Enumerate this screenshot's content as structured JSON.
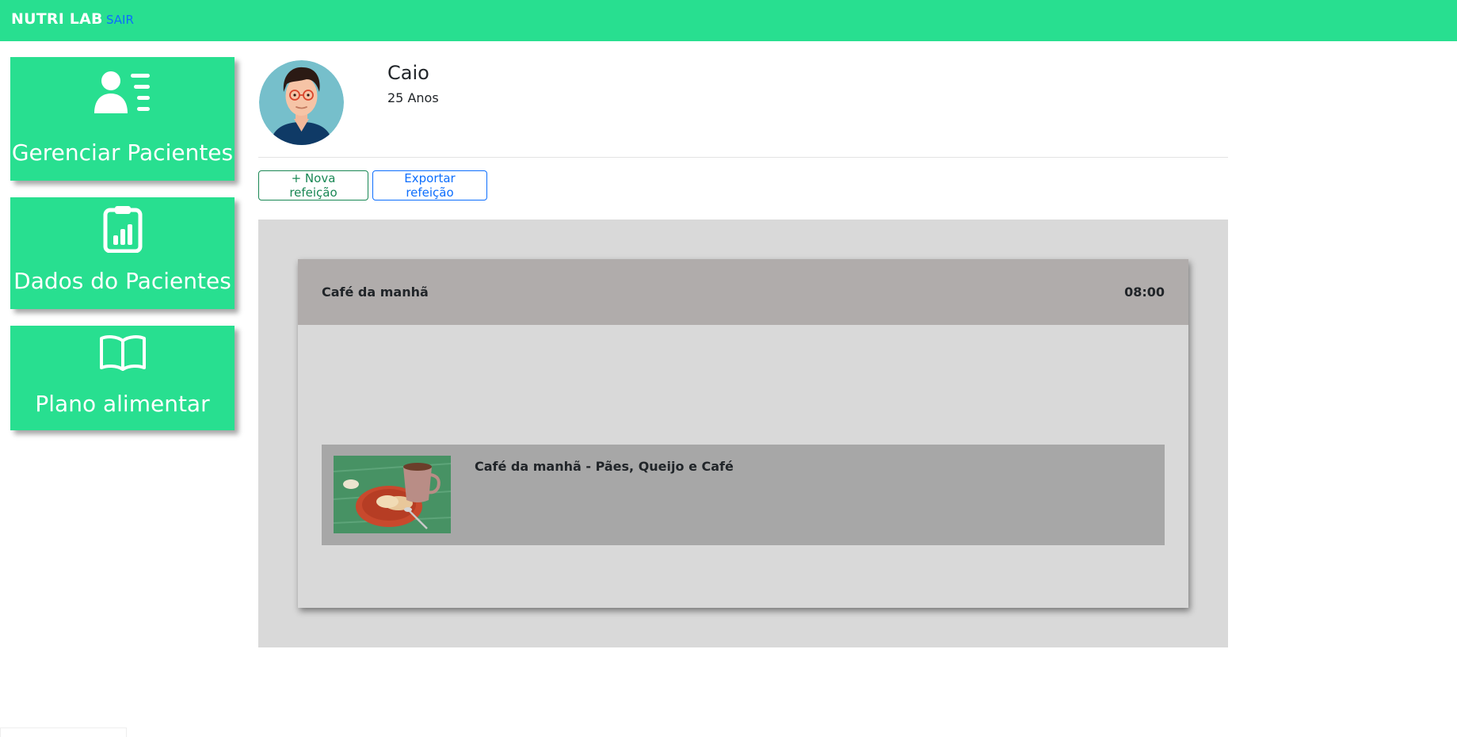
{
  "topbar": {
    "brand": "NUTRI LAB",
    "logout_label": "SAIR",
    "background": "#28df90"
  },
  "sidebar": {
    "items": [
      {
        "label": "Gerenciar Pacientes",
        "icon": "users-list-icon"
      },
      {
        "label": "Dados do Pacientes",
        "icon": "clipboard-chart-icon"
      },
      {
        "label": "Plano alimentar",
        "icon": "open-book-icon"
      }
    ]
  },
  "patient": {
    "name": "Caio",
    "age": "25 Anos"
  },
  "actions": {
    "new_meal": "+ Nova refeição",
    "export_meal": "Exportar refeição"
  },
  "meals": [
    {
      "title": "Café da manhã",
      "time": "08:00",
      "items": [
        {
          "name": "Café da manhã - Pães, Queijo e Café"
        }
      ]
    }
  ],
  "colors": {
    "accent": "#28df90",
    "success": "#198754",
    "primary": "#0d6efd",
    "meal_area": "#d9d9d9",
    "meal_header": "#b0acab",
    "food_item": "#a7a7a7"
  }
}
